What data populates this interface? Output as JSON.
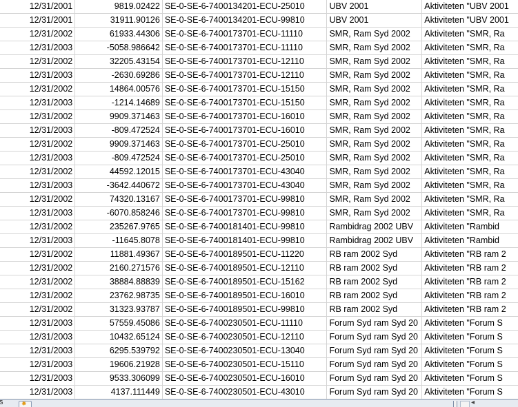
{
  "sheet_tabs": {
    "partial_label": "ts"
  },
  "rows": [
    {
      "date": "12/31/2001",
      "amount": "9819.02422",
      "code": "SE-0-SE-6-7400134201-ECU-25010",
      "project": "UBV 2001",
      "desc": "Aktiviteten \"UBV 2001"
    },
    {
      "date": "12/31/2001",
      "amount": "31911.90126",
      "code": "SE-0-SE-6-7400134201-ECU-99810",
      "project": "UBV 2001",
      "desc": "Aktiviteten \"UBV 2001"
    },
    {
      "date": "12/31/2002",
      "amount": "61933.44306",
      "code": "SE-0-SE-6-7400173701-ECU-11110",
      "project": "SMR, Ram Syd 2002",
      "desc": "Aktiviteten \"SMR, Ra"
    },
    {
      "date": "12/31/2003",
      "amount": "-5058.986642",
      "code": "SE-0-SE-6-7400173701-ECU-11110",
      "project": "SMR, Ram Syd 2002",
      "desc": "Aktiviteten \"SMR, Ra"
    },
    {
      "date": "12/31/2002",
      "amount": "32205.43154",
      "code": "SE-0-SE-6-7400173701-ECU-12110",
      "project": "SMR, Ram Syd 2002",
      "desc": "Aktiviteten \"SMR, Ra"
    },
    {
      "date": "12/31/2003",
      "amount": "-2630.69286",
      "code": "SE-0-SE-6-7400173701-ECU-12110",
      "project": "SMR, Ram Syd 2002",
      "desc": "Aktiviteten \"SMR, Ra"
    },
    {
      "date": "12/31/2002",
      "amount": "14864.00576",
      "code": "SE-0-SE-6-7400173701-ECU-15150",
      "project": "SMR, Ram Syd 2002",
      "desc": "Aktiviteten \"SMR, Ra"
    },
    {
      "date": "12/31/2003",
      "amount": "-1214.14689",
      "code": "SE-0-SE-6-7400173701-ECU-15150",
      "project": "SMR, Ram Syd 2002",
      "desc": "Aktiviteten \"SMR, Ra"
    },
    {
      "date": "12/31/2002",
      "amount": "9909.371463",
      "code": "SE-0-SE-6-7400173701-ECU-16010",
      "project": "SMR, Ram Syd 2002",
      "desc": "Aktiviteten \"SMR, Ra"
    },
    {
      "date": "12/31/2003",
      "amount": "-809.472524",
      "code": "SE-0-SE-6-7400173701-ECU-16010",
      "project": "SMR, Ram Syd 2002",
      "desc": "Aktiviteten \"SMR, Ra"
    },
    {
      "date": "12/31/2002",
      "amount": "9909.371463",
      "code": "SE-0-SE-6-7400173701-ECU-25010",
      "project": "SMR, Ram Syd 2002",
      "desc": "Aktiviteten \"SMR, Ra"
    },
    {
      "date": "12/31/2003",
      "amount": "-809.472524",
      "code": "SE-0-SE-6-7400173701-ECU-25010",
      "project": "SMR, Ram Syd 2002",
      "desc": "Aktiviteten \"SMR, Ra"
    },
    {
      "date": "12/31/2002",
      "amount": "44592.12015",
      "code": "SE-0-SE-6-7400173701-ECU-43040",
      "project": "SMR, Ram Syd 2002",
      "desc": "Aktiviteten \"SMR, Ra"
    },
    {
      "date": "12/31/2003",
      "amount": "-3642.440672",
      "code": "SE-0-SE-6-7400173701-ECU-43040",
      "project": "SMR, Ram Syd 2002",
      "desc": "Aktiviteten \"SMR, Ra"
    },
    {
      "date": "12/31/2002",
      "amount": "74320.13167",
      "code": "SE-0-SE-6-7400173701-ECU-99810",
      "project": "SMR, Ram Syd 2002",
      "desc": "Aktiviteten \"SMR, Ra"
    },
    {
      "date": "12/31/2003",
      "amount": "-6070.858246",
      "code": "SE-0-SE-6-7400173701-ECU-99810",
      "project": "SMR, Ram Syd 2002",
      "desc": "Aktiviteten \"SMR, Ra"
    },
    {
      "date": "12/31/2002",
      "amount": "235267.9765",
      "code": "SE-0-SE-6-7400181401-ECU-99810",
      "project": "Rambidrag 2002 UBV",
      "desc": "Aktiviteten \"Rambid"
    },
    {
      "date": "12/31/2003",
      "amount": "-11645.8078",
      "code": "SE-0-SE-6-7400181401-ECU-99810",
      "project": "Rambidrag 2002 UBV",
      "desc": "Aktiviteten \"Rambid"
    },
    {
      "date": "12/31/2002",
      "amount": "11881.49367",
      "code": "SE-0-SE-6-7400189501-ECU-11220",
      "project": "RB ram 2002 Syd",
      "desc": "Aktiviteten \"RB ram 2"
    },
    {
      "date": "12/31/2002",
      "amount": "2160.271576",
      "code": "SE-0-SE-6-7400189501-ECU-12110",
      "project": "RB ram 2002 Syd",
      "desc": "Aktiviteten \"RB ram 2"
    },
    {
      "date": "12/31/2002",
      "amount": "38884.88839",
      "code": "SE-0-SE-6-7400189501-ECU-15162",
      "project": "RB ram 2002 Syd",
      "desc": "Aktiviteten \"RB ram 2"
    },
    {
      "date": "12/31/2002",
      "amount": "23762.98735",
      "code": "SE-0-SE-6-7400189501-ECU-16010",
      "project": "RB ram 2002 Syd",
      "desc": "Aktiviteten \"RB ram 2"
    },
    {
      "date": "12/31/2002",
      "amount": "31323.93787",
      "code": "SE-0-SE-6-7400189501-ECU-99810",
      "project": "RB ram 2002 Syd",
      "desc": "Aktiviteten \"RB ram 2"
    },
    {
      "date": "12/31/2003",
      "amount": "57559.45086",
      "code": "SE-0-SE-6-7400230501-ECU-11110",
      "project": "Forum Syd ram Syd 20",
      "desc": "Aktiviteten \"Forum S"
    },
    {
      "date": "12/31/2003",
      "amount": "10432.65124",
      "code": "SE-0-SE-6-7400230501-ECU-12110",
      "project": "Forum Syd ram Syd 20",
      "desc": "Aktiviteten \"Forum S"
    },
    {
      "date": "12/31/2003",
      "amount": "6295.539792",
      "code": "SE-0-SE-6-7400230501-ECU-13040",
      "project": "Forum Syd ram Syd 20",
      "desc": "Aktiviteten \"Forum S"
    },
    {
      "date": "12/31/2003",
      "amount": "19606.21928",
      "code": "SE-0-SE-6-7400230501-ECU-15110",
      "project": "Forum Syd ram Syd 20",
      "desc": "Aktiviteten \"Forum S"
    },
    {
      "date": "12/31/2003",
      "amount": "9533.306099",
      "code": "SE-0-SE-6-7400230501-ECU-16010",
      "project": "Forum Syd ram Syd 20",
      "desc": "Aktiviteten \"Forum S"
    },
    {
      "date": "12/31/2003",
      "amount": "4137.111449",
      "code": "SE-0-SE-6-7400230501-ECU-43010",
      "project": "Forum Syd ram Syd 20",
      "desc": "Aktiviteten \"Forum S"
    }
  ]
}
